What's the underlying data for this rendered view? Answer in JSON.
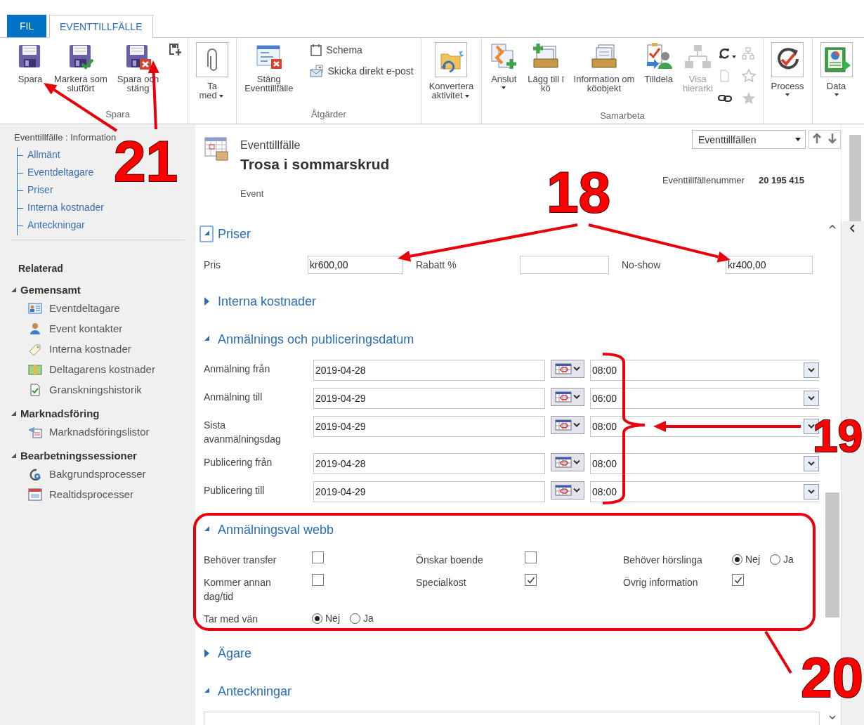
{
  "ribbon": {
    "tabs": [
      {
        "label": "FIL",
        "selected": false,
        "kind": "file"
      },
      {
        "label": "EVENTTILLFÄLLE",
        "selected": true,
        "kind": "tab"
      }
    ],
    "groups": [
      {
        "label": "Spara",
        "items": [
          {
            "kind": "large",
            "label": "Spara"
          },
          {
            "kind": "large",
            "label": "Markera som\nslutfört"
          },
          {
            "kind": "large",
            "label": "Spara och\nstäng"
          },
          {
            "kind": "icon"
          }
        ]
      },
      {
        "items": [
          {
            "kind": "boxed",
            "label": "Ta\nmed",
            "menu": true
          }
        ]
      },
      {
        "label": "Åtgärder",
        "items": [
          {
            "kind": "large",
            "label": "Stäng\nEventtillfälle"
          },
          {
            "kind": "stack",
            "entries": [
              "Schema",
              "Skicka direkt e-post"
            ]
          }
        ]
      },
      {
        "items": [
          {
            "kind": "boxed",
            "label": "Konvertera\naktivitet",
            "menu": true
          }
        ]
      },
      {
        "label": "Samarbeta",
        "items": [
          {
            "kind": "large",
            "label": "Anslut",
            "menu": true
          },
          {
            "kind": "large",
            "label": "Lägg till i\nkö"
          },
          {
            "kind": "large",
            "label": "Information om\nköobjekt"
          },
          {
            "kind": "large",
            "label": "Tilldela"
          },
          {
            "kind": "large",
            "label": "Visa\nhierarki",
            "disabled": true
          },
          {
            "kind": "icongrid"
          }
        ]
      },
      {
        "items": [
          {
            "kind": "boxed",
            "label": "Process",
            "menu": true
          }
        ]
      },
      {
        "items": [
          {
            "kind": "boxed",
            "label": "Data",
            "menu": true
          }
        ]
      }
    ]
  },
  "nav": {
    "title": "Eventtillfälle : Information",
    "links": [
      "Allmänt",
      "Eventdeltagare",
      "Priser",
      "Interna kostnader",
      "Anteckningar"
    ],
    "related_title": "Relaterad",
    "groups": [
      {
        "label": "Gemensamt",
        "expanded": true,
        "items": [
          "Eventdeltagare",
          "Event kontakter",
          "Interna kostnader",
          "Deltagarens kostnader",
          "Granskningshistorik"
        ]
      },
      {
        "label": "Marknadsföring",
        "expanded": true,
        "items": [
          "Marknadsföringslistor"
        ]
      },
      {
        "label": "Bearbetningssessioner",
        "expanded": true,
        "items": [
          "Bakgrundsprocesser",
          "Realtidsprocesser"
        ]
      }
    ]
  },
  "record": {
    "entity": "Eventtillfälle",
    "title": "Trosa i sommarskrud",
    "type": "Event",
    "number_label": "Eventtillfällenummer",
    "number": "20 195 415",
    "view_selector": "Eventtillfällen"
  },
  "sections": [
    {
      "title": "Priser",
      "expanded": true,
      "focused": true,
      "kind": "fields",
      "fields": [
        {
          "label": "Pris",
          "value": "kr600,00"
        },
        {
          "label": "Rabatt %"
        },
        {
          "label": "No-show",
          "value": "kr400,00"
        }
      ]
    },
    {
      "title": "Interna kostnader",
      "expanded": false,
      "focused": false
    },
    {
      "title": "Anmälnings och publiceringsdatum",
      "expanded": true,
      "focused": false,
      "kind": "dates",
      "rows": [
        {
          "label": "Anmälning från",
          "date": "2019-04-28",
          "time": "08:00"
        },
        {
          "label": "Anmälning till",
          "date": "2019-04-29",
          "time": "06:00"
        },
        {
          "label": "Sista avanmälningsdag",
          "date": "2019-04-29",
          "time": "08:00"
        },
        {
          "label": "Publicering från",
          "date": "2019-04-28",
          "time": "08:00"
        },
        {
          "label": "Publicering till",
          "date": "2019-04-29",
          "time": "08:00"
        }
      ]
    },
    {
      "title": "Anmälningsval webb",
      "expanded": true,
      "focused": false,
      "kind": "options",
      "fields": [
        {
          "label": "Behöver transfer",
          "kind": "checkbox",
          "checked": false
        },
        {
          "label": "Önskar boende",
          "kind": "checkbox",
          "checked": false
        },
        {
          "label": "Behöver hörslinga",
          "kind": "radio",
          "options": [
            {
              "label": "Nej",
              "selected": true
            },
            {
              "label": "Ja",
              "selected": false
            }
          ]
        },
        {
          "label": "Kommer annan\ndag/tid",
          "kind": "checkbox",
          "checked": false
        },
        {
          "label": "Specialkost",
          "kind": "checkbox",
          "checked": true
        },
        {
          "label": "Övrig information",
          "kind": "checkbox",
          "checked": true
        },
        {
          "label": "Tar med vän",
          "kind": "radio",
          "options": [
            {
              "label": "Nej",
              "selected": true
            },
            {
              "label": "Ja",
              "selected": false
            }
          ]
        }
      ]
    },
    {
      "title": "Ägare",
      "expanded": false,
      "focused": false
    },
    {
      "title": "Anteckningar",
      "expanded": true,
      "focused": false,
      "kind": "notes"
    }
  ],
  "annotations": [
    {
      "label": "21"
    },
    {
      "label": "18"
    },
    {
      "label": "19"
    },
    {
      "label": "20"
    }
  ]
}
